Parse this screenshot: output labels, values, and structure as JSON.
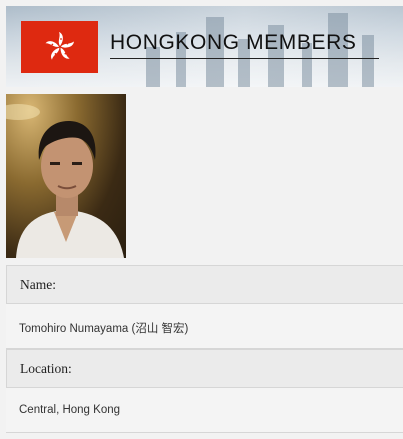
{
  "header": {
    "title": "HONGKONG MEMBERS",
    "flag_icon": "hong-kong-flag-icon",
    "flag_color": "#de2910"
  },
  "profile": {
    "photo_icon": "member-portrait",
    "fields": [
      {
        "label": "Name:",
        "value": "Tomohiro Numayama (沼山 智宏)"
      },
      {
        "label": "Location:",
        "value": "Central, Hong Kong"
      }
    ]
  }
}
